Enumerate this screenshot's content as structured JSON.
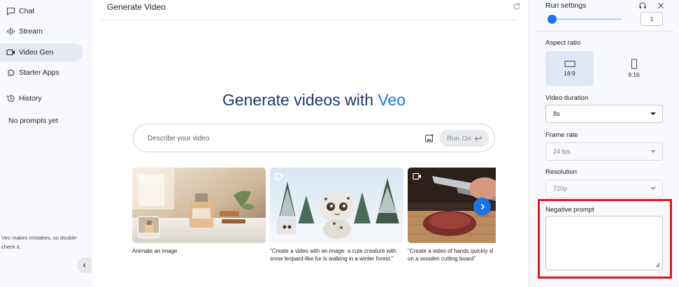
{
  "sidebar": {
    "items": [
      {
        "label": "Chat",
        "icon": "chat-icon"
      },
      {
        "label": "Stream",
        "icon": "stream-icon"
      },
      {
        "label": "Video Gen",
        "icon": "video-icon"
      },
      {
        "label": "Starter Apps",
        "icon": "apps-icon"
      },
      {
        "label": "History",
        "icon": "history-icon"
      }
    ],
    "active": "Video Gen",
    "no_prompts": "No prompts yet",
    "disclaimer": "Veo makes mistakes, so double-check it."
  },
  "main": {
    "title": "Generate Video",
    "hero_prefix": "Generate videos with",
    "hero_accent": "Veo",
    "prompt": {
      "value": "",
      "placeholder": "Describe your video",
      "run_label": "Run",
      "shortcut": "Ctrl"
    },
    "cards": [
      {
        "caption": "Animate an image"
      },
      {
        "caption": "\"Create a video with an image: a cute creature with snow leopard-like fur is walking in a winter forest.\""
      },
      {
        "caption": "\"Create a video of hands quickly sl on a wooden cutting board\""
      }
    ]
  },
  "settings": {
    "title": "Run settings",
    "count_value": "1",
    "aspect_label": "Aspect ratio",
    "aspect_options": [
      "16:9",
      "9:16"
    ],
    "aspect_selected": "16:9",
    "duration_label": "Video duration",
    "duration_value": "8s",
    "framerate_label": "Frame rate",
    "framerate_value": "24 fps",
    "resolution_label": "Resolution",
    "resolution_value": "720p",
    "negative_label": "Negative prompt",
    "negative_value": ""
  },
  "colors": {
    "accent": "#1a73e8",
    "hero_text": "#1b3b6f",
    "highlight": "#e2161a",
    "sidebar_bg": "#f8f9fc"
  }
}
